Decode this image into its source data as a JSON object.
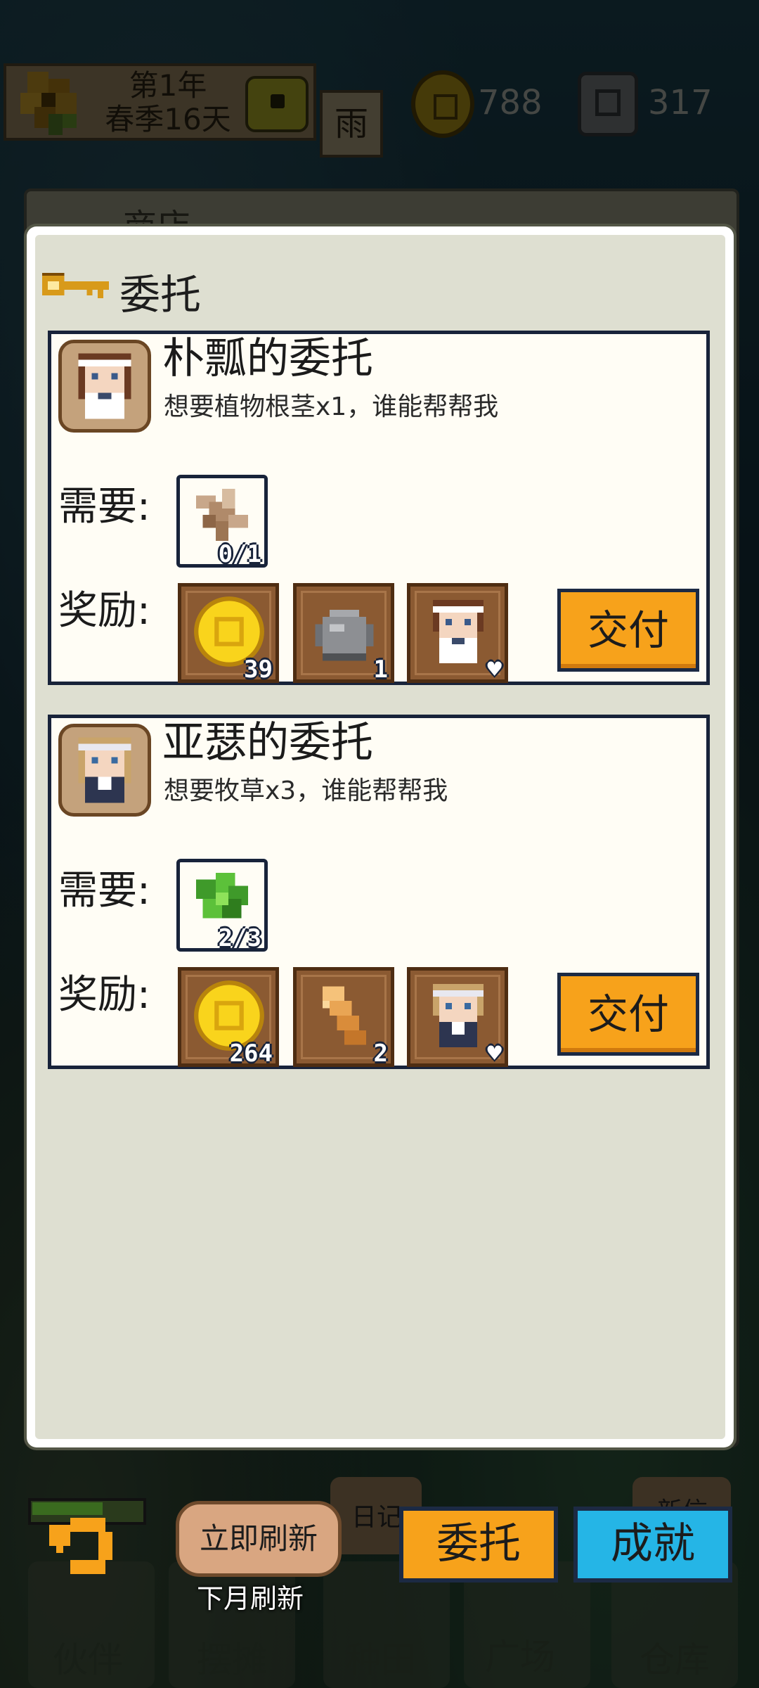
{
  "hud": {
    "year": "第1年",
    "season_day": "春季16天",
    "weather": "雨",
    "coins": "788",
    "gems": "317"
  },
  "background": {
    "panel_title": "商店",
    "diary": "日记",
    "new_label": "新信"
  },
  "modal": {
    "title": "委托",
    "need_label": "需要:",
    "reward_label": "奖励:",
    "deliver_label": "交付",
    "commissions": [
      {
        "title": "朴瓢的委托",
        "desc": "想要植物根茎x1，谁能帮帮我",
        "need_item": "plant-root-icon",
        "need_count": "0/1",
        "rewards": [
          {
            "icon": "gold-coin-icon",
            "count": "39"
          },
          {
            "icon": "stone-icon",
            "count": "1"
          },
          {
            "icon": "npc-portrait-icon",
            "count": "♥"
          }
        ]
      },
      {
        "title": "亚瑟的委托",
        "desc": "想要牧草x3，谁能帮帮我",
        "need_item": "forage-grass-icon",
        "need_count": "2/3",
        "rewards": [
          {
            "icon": "gold-coin-icon",
            "count": "264"
          },
          {
            "icon": "feather-icon",
            "count": "2"
          },
          {
            "icon": "npc-portrait-icon",
            "count": "♥"
          }
        ]
      }
    ]
  },
  "bottom": {
    "refresh_now": "立即刷新",
    "refresh_next_month": "下月刷新",
    "tab_commission": "委托",
    "tab_achievement": "成就",
    "nav": [
      "伙伴",
      "摆摊",
      "种田",
      "广场",
      "仓库"
    ]
  },
  "colors": {
    "accent_orange": "#f7a21b",
    "accent_blue": "#25b5e6",
    "card_border": "#18233a"
  }
}
